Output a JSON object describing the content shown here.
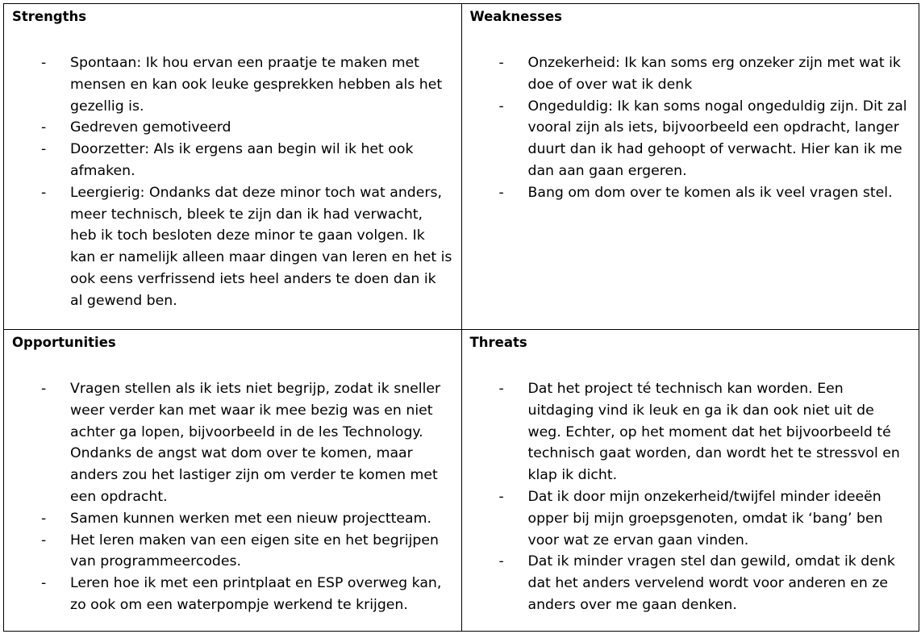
{
  "swot": {
    "strengths": {
      "title": "Strengths",
      "items": [
        "Spontaan: Ik hou ervan een praatje te maken met mensen en kan ook leuke gesprekken hebben als het gezellig is.",
        "Gedreven gemotiveerd",
        "Doorzetter: Als ik ergens aan begin wil ik het ook afmaken.",
        "Leergierig: Ondanks dat deze minor toch wat anders, meer technisch, bleek te zijn dan ik had verwacht, heb ik toch besloten deze minor te gaan volgen. Ik kan er namelijk alleen maar dingen van leren en het is ook eens verfrissend iets heel anders te doen dan ik al gewend ben."
      ]
    },
    "weaknesses": {
      "title": "Weaknesses",
      "items": [
        "Onzekerheid: Ik kan soms erg onzeker zijn met wat ik doe of over wat ik denk",
        "Ongeduldig: Ik kan soms nogal ongeduldig zijn. Dit zal vooral zijn als iets, bijvoorbeeld een opdracht, langer duurt dan ik had gehoopt of verwacht. Hier kan ik me dan aan gaan ergeren.",
        "Bang om dom over te komen als ik veel vragen stel."
      ]
    },
    "opportunities": {
      "title": "Opportunities",
      "items": [
        "Vragen stellen als ik iets niet begrijp, zodat ik sneller weer verder kan met waar ik mee bezig was en niet achter ga lopen, bijvoorbeeld in de les Technology. Ondanks de angst wat dom over te komen, maar anders zou het lastiger zijn om verder te komen met een opdracht.",
        "Samen kunnen werken met een nieuw projectteam.",
        "Het leren maken van een eigen site en het begrijpen van programmeercodes.",
        "Leren hoe ik met een printplaat en ESP overweg kan, zo ook om een waterpompje werkend te krijgen."
      ]
    },
    "threats": {
      "title": "Threats",
      "items": [
        "Dat het project té technisch kan worden. Een uitdaging vind ik leuk en ga ik dan ook niet uit de weg. Echter, op het moment dat het bijvoorbeeld té technisch gaat worden, dan wordt het te stressvol en klap ik dicht.",
        "Dat ik door mijn onzekerheid/twijfel minder ideeën opper bij mijn groepsgenoten, omdat ik ‘bang’ ben voor wat ze ervan gaan vinden.",
        "Dat ik minder vragen stel dan gewild, omdat ik denk dat het anders vervelend wordt voor anderen en ze anders over me gaan denken."
      ]
    },
    "bullet": "-"
  }
}
